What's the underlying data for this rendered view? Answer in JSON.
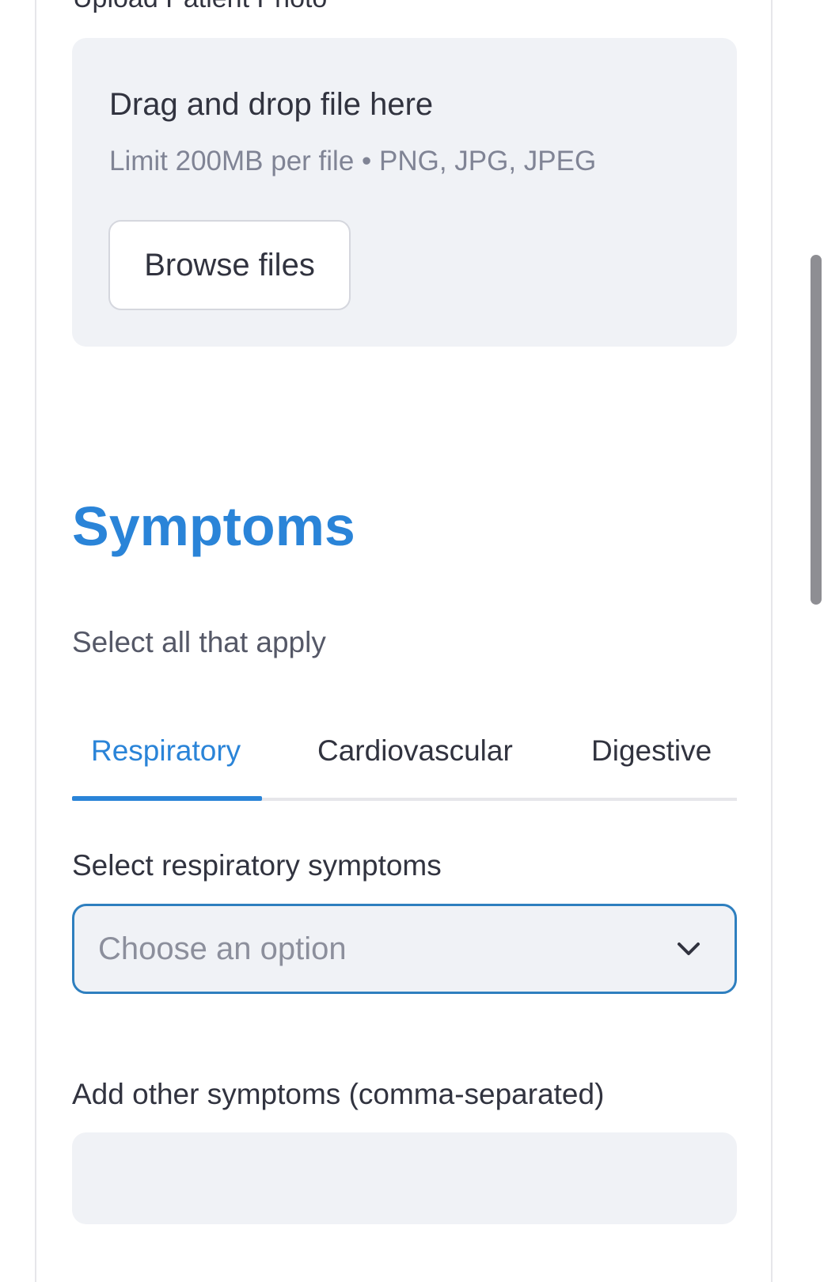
{
  "upload": {
    "label": "Upload Patient Photo",
    "dropzone_title": "Drag and drop file here",
    "dropzone_limit": "Limit 200MB per file • PNG, JPG, JPEG",
    "browse_button": "Browse files"
  },
  "symptoms": {
    "title": "Symptoms",
    "subtitle": "Select all that apply",
    "tabs": [
      {
        "label": "Respiratory",
        "active": true
      },
      {
        "label": "Cardiovascular",
        "active": false
      },
      {
        "label": "Digestive",
        "active": false
      }
    ],
    "select_label": "Select respiratory symptoms",
    "select_placeholder": "Choose an option",
    "other_label": "Add other symptoms (comma-separated)",
    "other_value": ""
  },
  "icons": {
    "select": "chevron-down-icon"
  },
  "colors": {
    "accent": "#2a84d8",
    "input_bg": "#f0f2f6",
    "focus_border": "#2e7fbf",
    "muted_text": "#808495",
    "body_text": "#31333f"
  }
}
